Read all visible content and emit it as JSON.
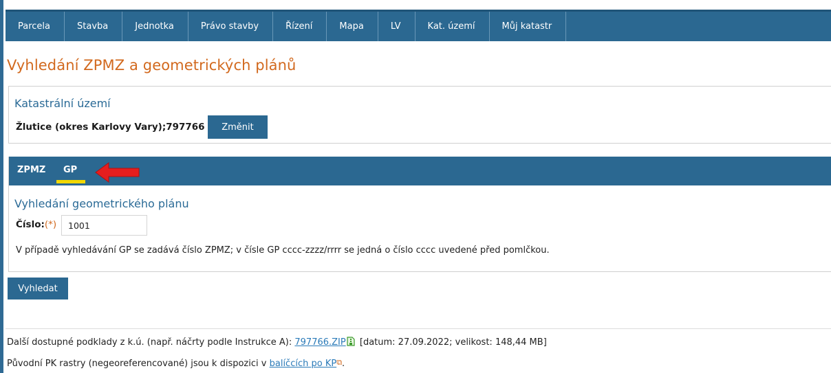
{
  "nav": {
    "items": [
      "Parcela",
      "Stavba",
      "Jednotka",
      "Právo stavby",
      "Řízení",
      "Mapa",
      "LV",
      "Kat. území",
      "Můj katastr"
    ]
  },
  "page_title": "Vyhledání ZPMZ a geometrických plánů",
  "ku_section": {
    "heading": "Katastrální území",
    "value": "Žlutice (okres Karlovy Vary);797766",
    "change_button": "Změnit"
  },
  "tabs": {
    "zpmz": "ZPMZ",
    "gp": "GP",
    "active": "GP"
  },
  "gp_section": {
    "heading": "Vyhledání geometrického plánu",
    "cislo_label": "Číslo:",
    "required_mark": "(*)",
    "cislo_value": "1001",
    "hint": "V případě vyhledávání GP se zadává číslo ZPMZ; v čísle GP cccc-zzzz/rrrr se jedná o číslo cccc uvedené před pomlčkou."
  },
  "search_button": "Vyhledat",
  "footer": {
    "line1_prefix": "Další dostupné podklady z k.ú. (např. náčrty podle Instrukce A):",
    "zip_link": "797766.ZIP",
    "line1_suffix": "[datum: 27.09.2022; velikost: 148,44 MB]",
    "line2_prefix": "Původní PK rastry (negeoreferencované) jsou k dispozici v",
    "packages_link": "balíčcích po KP",
    "line2_suffix": "."
  },
  "icons": {
    "zip": "zip-file-icon",
    "external": "external-link-icon",
    "annotation": "red-arrow-annotation"
  },
  "colors": {
    "nav_bg": "#2b6891",
    "title": "#d2691e",
    "heading": "#2a6a96",
    "tab_underline": "#f2d700",
    "arrow": "#e61e1e"
  }
}
